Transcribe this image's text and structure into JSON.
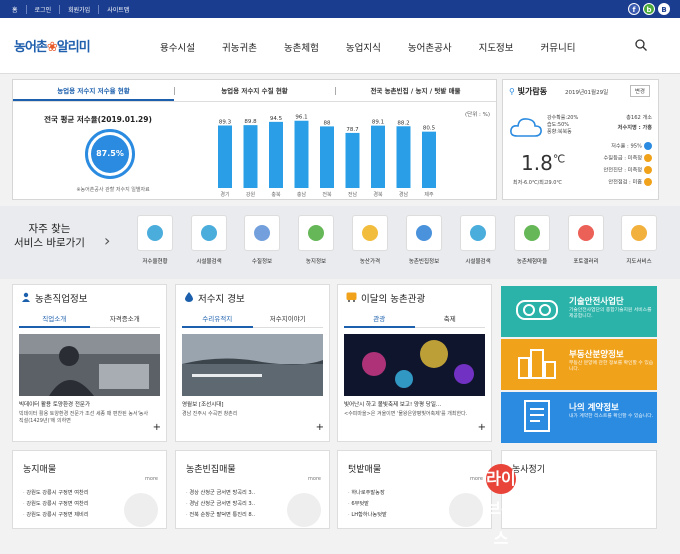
{
  "topbar": {
    "links": [
      "홈",
      "로그인",
      "회원가입",
      "사이트맵"
    ],
    "sns": [
      "f",
      "b",
      "B"
    ]
  },
  "logo": {
    "part1": "농어촌",
    "part2": "알리미"
  },
  "nav": [
    "용수시설",
    "귀농귀촌",
    "농촌체험",
    "농업지식",
    "농어촌공사",
    "지도정보",
    "커뮤니티"
  ],
  "panel1": {
    "tabs": [
      "농업용 저수지 저수율 현황",
      "농업용 저수지 수질 현황",
      "전국 농촌빈집 / 농지 / 텃밭 매물"
    ],
    "avg_title": "전국 평균 저수율(2019.01.29)",
    "avg_value": "87.5%",
    "note": "※농어촌공사 관할 저수지 일별자료",
    "unit": "(단위 : %)"
  },
  "chart_data": {
    "type": "bar",
    "categories": [
      "경기",
      "강원",
      "충북",
      "충남",
      "전북",
      "전남",
      "경북",
      "경남",
      "제주"
    ],
    "values": [
      89.3,
      89.8,
      94.5,
      96.1,
      88,
      78.7,
      89.1,
      88.2,
      80.5
    ],
    "ylim": [
      0,
      100
    ]
  },
  "weather": {
    "location": "빛가람동",
    "date": "2019년01월29일",
    "change": "변경",
    "humidity_rain": "강수확률:20%",
    "humidity": "습도:50%",
    "wind": "풍향:북북동",
    "temp": "1.8",
    "unit": "℃",
    "minmax": "최저-6.0℃/최고9.0℃",
    "right": [
      "총162 개소",
      "저수지명 : 가흥",
      "저수율 : 95%",
      "수질등급 : 미측정",
      "안전진단 : 미측정",
      "안전점검 : 미흡"
    ],
    "colors": {
      "accent": "#2a8be0",
      "orange": "#f0a21b"
    }
  },
  "services": {
    "title1": "자주 찾는",
    "title2": "서비스 바로가기",
    "items": [
      "저수율현황",
      "시설물검색",
      "수질정보",
      "농지정보",
      "농산가격",
      "농촌빈집정보",
      "시설물검색",
      "농촌체험마을",
      "포토갤러리",
      "지도서비스"
    ]
  },
  "cards": [
    {
      "title": "농촌직업정보",
      "tabs": [
        "직업소개",
        "자격증소개"
      ],
      "caption": "빅데이터 활용 토양환경 전문가",
      "desc": "빅데이터 활용 토양환경 전문가 조선 세종 때 편찬된 농서'농사직설(1429년)'에 의하면"
    },
    {
      "title": "저수지 경보",
      "tabs": [
        "수리유적지",
        "저수지이야기"
      ],
      "caption": "영월보 [조선시대]",
      "desc": "경남 진주시 수곡면 창촌리"
    },
    {
      "title": "이달의 농촌관광",
      "tabs": [
        "관광",
        "축제"
      ],
      "caption": "빛어난시 하고 볼빛축제 보고! 양평 당일...",
      "desc": "<수피마을>은 겨울이면 '물왕은양평빛어축제'를 개최한다."
    }
  ],
  "banners": [
    {
      "title": "기술안전사업단",
      "desc": "기술안전사업단의 종합기술지원 서비스를 제공합니다.",
      "color": "#2bb3a9"
    },
    {
      "title": "부동산분양정보",
      "desc": "부동산 분양에 관한 정보를 확인할 수 있습니다.",
      "color": "#f0a21b"
    },
    {
      "title": "나의 계약정보",
      "desc": "내가 계약한 리스트를 확인할 수 있습니다.",
      "color": "#2a8be0"
    }
  ],
  "bottom": [
    {
      "title": "농지매물",
      "more": "more",
      "items": [
        "강원도 강릉시 구정면 여찬리",
        "강원도 강릉시 구정면 여찬리",
        "강원도 강릉시 구정면 제비리"
      ]
    },
    {
      "title": "농촌빈집매물",
      "more": "more",
      "items": [
        "경상 산청군 금서면 방곡리 3..",
        "경남 산청군 금서면 방곡리 3..",
        "전북 순창군 팔덕면 통진리 8.."
      ]
    },
    {
      "title": "텃밭매물",
      "more": "more",
      "items": [
        "하나로주말농장",
        "6무텃밭",
        "LH함하나농텃밭"
      ]
    },
    {
      "title": "농사정기",
      "more": "",
      "items": []
    }
  ],
  "watermark": "라이브뉴스"
}
